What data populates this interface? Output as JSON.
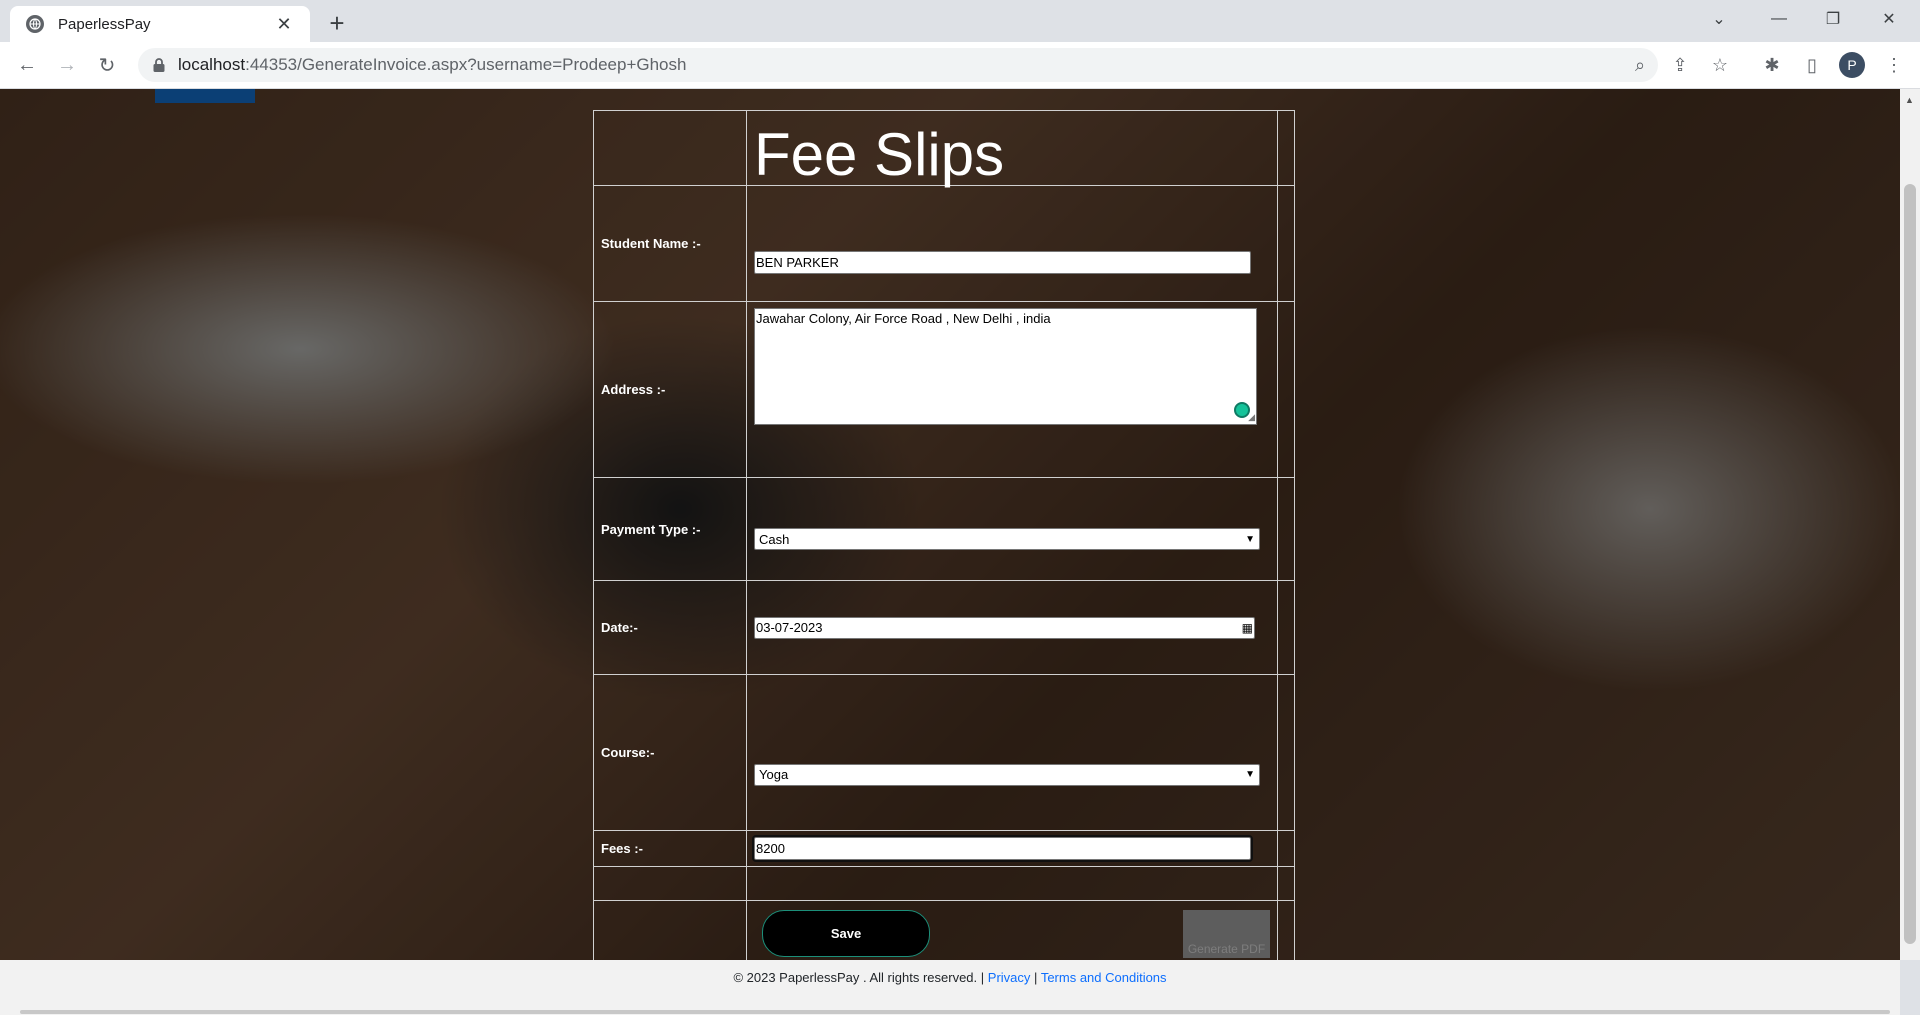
{
  "browser": {
    "tab_title": "PaperlessPay",
    "url_host": "localhost",
    "url_rest": ":44353/GenerateInvoice.aspx?username=Prodeep+Ghosh",
    "profile_initial": "P"
  },
  "form": {
    "title": "Fee Slips",
    "student_name_label": "Student Name :-",
    "student_name_value": "BEN PARKER",
    "address_label": "Address :-",
    "address_value": "Jawahar Colony, Air Force Road , New Delhi , india",
    "payment_type_label": "Payment Type :-",
    "payment_type_value": "Cash",
    "date_label": "Date:-",
    "date_value": "03-07-2023",
    "course_label": "Course:-",
    "course_value": "Yoga",
    "fees_label": "Fees :-",
    "fees_value": "8200",
    "save_label": "Save",
    "pdf_label": "Generate PDF"
  },
  "footer": {
    "copyright": "© 2023 PaperlessPay . All rights reserved. |",
    "privacy": "Privacy",
    "separator": "|",
    "terms": "Terms and Conditions"
  }
}
